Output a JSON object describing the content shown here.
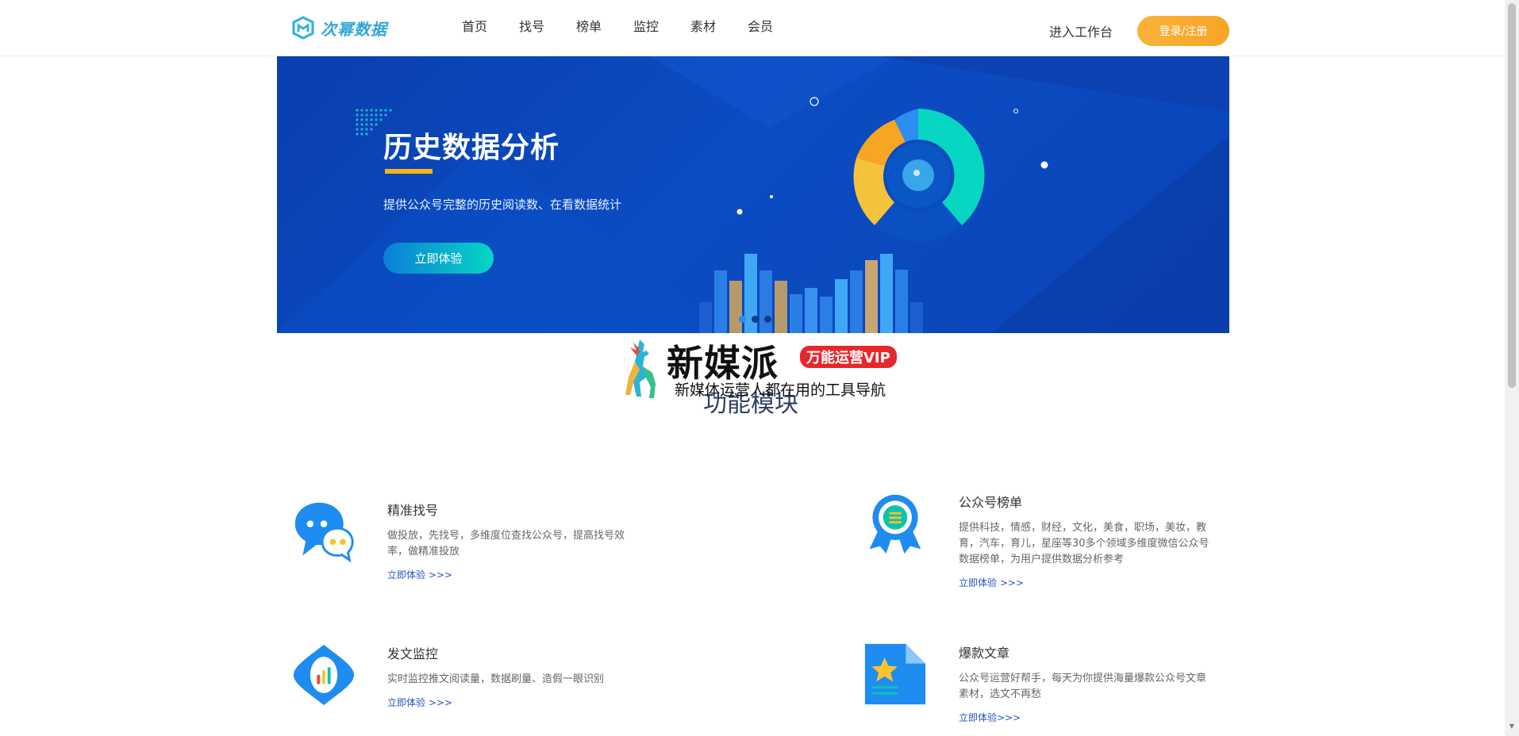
{
  "header": {
    "logo_text": "次幂数据",
    "nav": [
      {
        "label": "首页"
      },
      {
        "label": "找号"
      },
      {
        "label": "榜单"
      },
      {
        "label": "监控"
      },
      {
        "label": "素材"
      },
      {
        "label": "会员"
      }
    ],
    "workbench_label": "进入工作台",
    "login_label": "登录/注册"
  },
  "banner": {
    "title": "历史数据分析",
    "description": "提供公众号完整的历史阅读数、在看数据统计",
    "button_label": "立即体验",
    "slides_total": 3,
    "active_slide": 1
  },
  "ad": {
    "brand": "新媒派",
    "badge": "万能运营VIP",
    "subtitle": "新媒体运营人都在用的工具导航"
  },
  "section_title": "功能模块",
  "features": [
    {
      "title": "精准找号",
      "desc": "做投放，先找号，多维度位查找公众号，提高找号效率，做精准投放",
      "link": "立即体验 >>>",
      "icon": "chat-bubbles-icon"
    },
    {
      "title": "公众号榜单",
      "desc": "提供科技，情感，财经，文化，美食，职场，美妆，教育，汽车，育儿，星座等30多个领域多维度微信公众号数据榜单，为用户提供数据分析参考",
      "link": "立即体验 >>>",
      "icon": "award-badge-icon"
    },
    {
      "title": "发文监控",
      "desc": "实时监控推文阅读量，数据刷量、造假一眼识别",
      "link": "立即体验 >>>",
      "icon": "monitor-eye-icon"
    },
    {
      "title": "爆款文章",
      "desc": "公众号运营好帮手，每天为你提供海量爆款公众号文章素材，选文不再愁",
      "link": "立即体验>>>",
      "icon": "star-document-icon"
    }
  ],
  "colors": {
    "brand": "#2fa6d8",
    "login_button": "#f7a524",
    "banner_bg": "#0b4cc2",
    "accent_bar": "#f7b516",
    "link": "#2355c5",
    "vip_badge": "#e8262b"
  }
}
